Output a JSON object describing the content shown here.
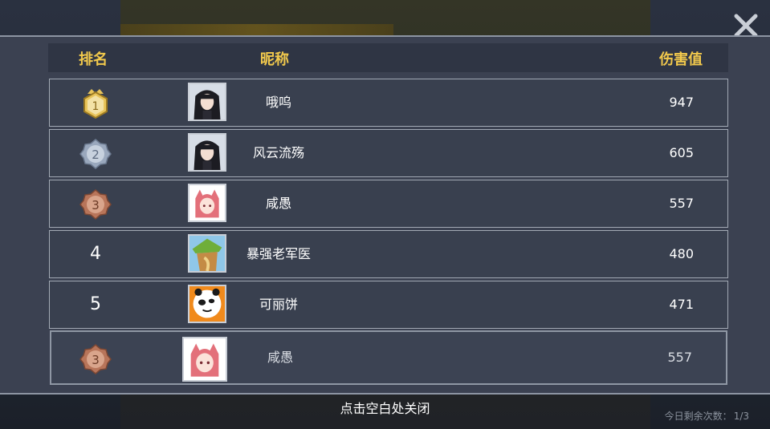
{
  "header": {
    "rank": "排名",
    "nickname": "昵称",
    "damage": "伤害值"
  },
  "rows": [
    {
      "rank": "1",
      "badge": "gold-crown-badge",
      "nickname": "哦呜",
      "damage": "947",
      "avatar": "dark-hair-girl-avatar"
    },
    {
      "rank": "2",
      "badge": "silver-badge",
      "nickname": "风云流殇",
      "damage": "605",
      "avatar": "dark-hair-girl-avatar"
    },
    {
      "rank": "3",
      "badge": "bronze-badge",
      "nickname": "咸愚",
      "damage": "557",
      "avatar": "pink-hair-girl-avatar"
    },
    {
      "rank": "4",
      "badge": null,
      "nickname": "暴强老军医",
      "damage": "480",
      "avatar": "green-hat-avatar"
    },
    {
      "rank": "5",
      "badge": null,
      "nickname": "可丽饼",
      "damage": "471",
      "avatar": "panda-avatar"
    }
  ],
  "self_row": {
    "rank": "3",
    "badge": "bronze-badge",
    "nickname": "咸愚",
    "damage": "557",
    "avatar": "pink-hair-girl-avatar"
  },
  "footer": {
    "hint": "点击空白处关闭",
    "remaining_label": "今日剩余次数：",
    "remaining_value": "1/3"
  },
  "colors": {
    "header_text": "#f2c94c",
    "panel": "#3b4151",
    "gold": "#e8c45a",
    "silver": "#9aa8bd",
    "bronze": "#b8755a"
  }
}
